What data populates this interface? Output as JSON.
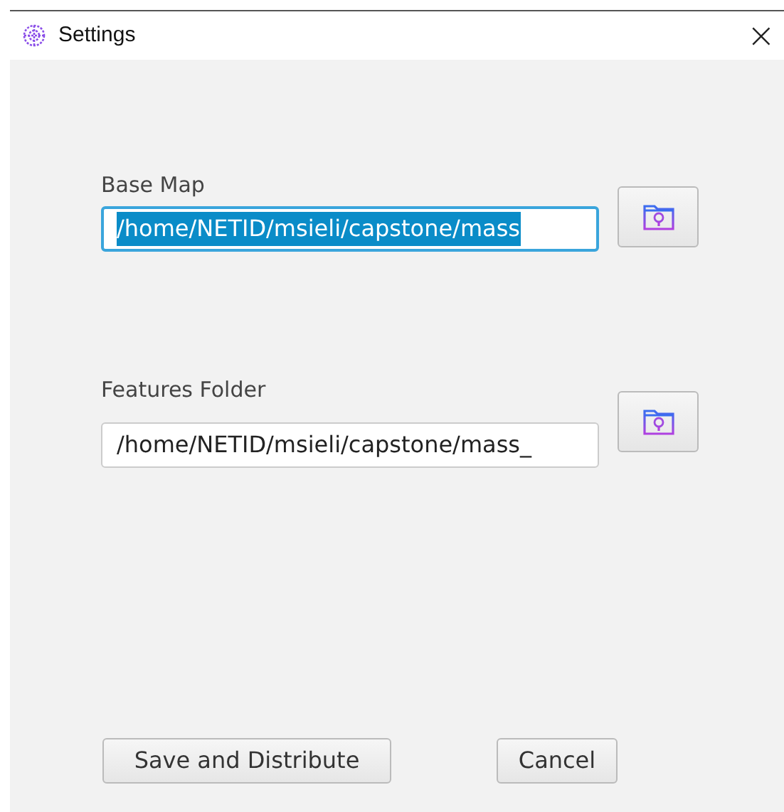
{
  "window": {
    "title": "Settings",
    "close": "×"
  },
  "fields": [
    {
      "label": "Base Map",
      "value": "/home/NETID/msieli/capstone/mass",
      "focused": true,
      "text_selected": true
    },
    {
      "label": "Features Folder",
      "value": "/home/NETID/msieli/capstone/mass_",
      "focused": false,
      "text_selected": false
    }
  ],
  "buttons": [
    {
      "label": "Save and Distribute"
    },
    {
      "label": "Cancel"
    }
  ]
}
